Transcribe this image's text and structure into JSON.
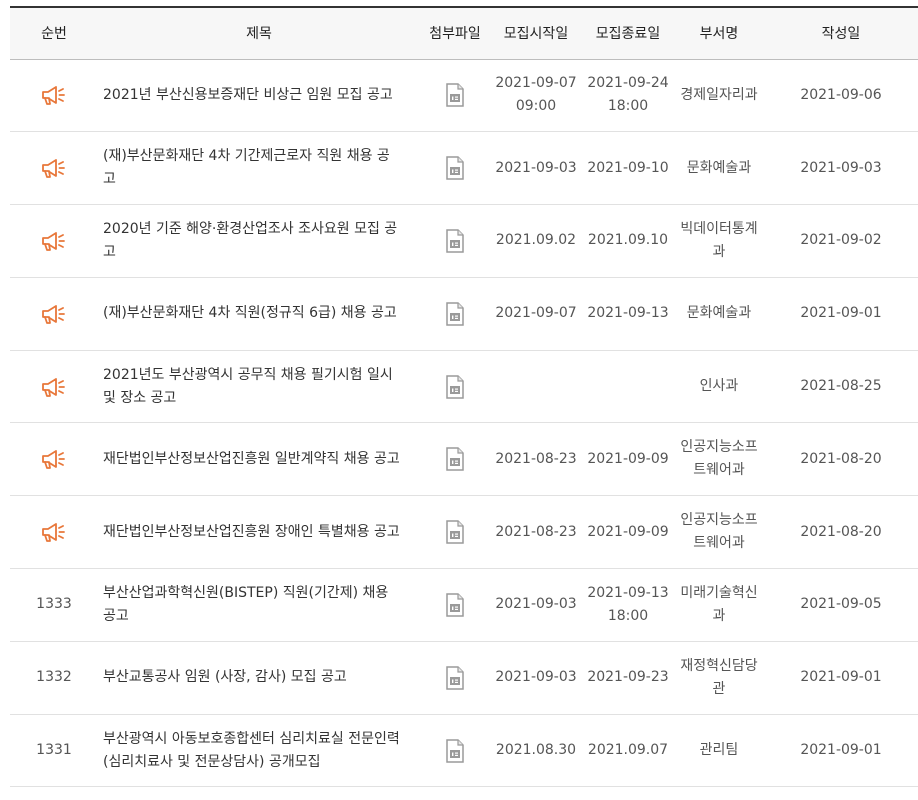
{
  "colors": {
    "notice_icon": "#e8773a",
    "file_icon": "#9a9a9a"
  },
  "columns": [
    "순번",
    "제목",
    "첨부파일",
    "모집시작일",
    "모집종료일",
    "부서명",
    "작성일"
  ],
  "rows": [
    {
      "no": "",
      "is_notice": true,
      "notice_icon": "megaphone-icon",
      "title": "2021년 부산신용보증재단 비상근 임원 모집 공고",
      "file_icon": "hwp-file-icon",
      "start": "2021-09-07 09:00",
      "end": "2021-09-24 18:00",
      "dept": "경제일자리과",
      "date": "2021-09-06"
    },
    {
      "no": "",
      "is_notice": true,
      "notice_icon": "megaphone-icon",
      "title": "(재)부산문화재단 4차 기간제근로자 직원 채용 공고",
      "file_icon": "hwp-file-icon",
      "start": "2021-09-03",
      "end": "2021-09-10",
      "dept": "문화예술과",
      "date": "2021-09-03"
    },
    {
      "no": "",
      "is_notice": true,
      "notice_icon": "megaphone-icon",
      "title": "2020년 기준 해양·환경산업조사 조사요원 모집 공고",
      "file_icon": "hwp-file-icon",
      "start": "2021.09.02",
      "end": "2021.09.10",
      "dept": "빅데이터통계과",
      "date": "2021-09-02"
    },
    {
      "no": "",
      "is_notice": true,
      "notice_icon": "megaphone-icon",
      "title": "(재)부산문화재단 4차 직원(정규직 6급) 채용 공고",
      "file_icon": "hwp-file-icon",
      "start": "2021-09-07",
      "end": "2021-09-13",
      "dept": "문화예술과",
      "date": "2021-09-01"
    },
    {
      "no": "",
      "is_notice": true,
      "notice_icon": "megaphone-icon",
      "title": "2021년도 부산광역시 공무직 채용 필기시험 일시 및 장소 공고",
      "file_icon": "hwp-file-icon",
      "start": "",
      "end": "",
      "dept": "인사과",
      "date": "2021-08-25"
    },
    {
      "no": "",
      "is_notice": true,
      "notice_icon": "megaphone-icon",
      "title": "재단법인부산정보산업진흥원 일반계약직 채용 공고",
      "file_icon": "hwp-file-icon",
      "start": "2021-08-23",
      "end": "2021-09-09",
      "dept": "인공지능소프트웨어과",
      "date": "2021-08-20"
    },
    {
      "no": "",
      "is_notice": true,
      "notice_icon": "megaphone-icon",
      "title": "재단법인부산정보산업진흥원 장애인 특별채용 공고",
      "file_icon": "hwp-file-icon",
      "start": "2021-08-23",
      "end": "2021-09-09",
      "dept": "인공지능소프트웨어과",
      "date": "2021-08-20"
    },
    {
      "no": "1333",
      "is_notice": false,
      "notice_icon": "",
      "title": "부산산업과학혁신원(BISTEP) 직원(기간제) 채용공고",
      "file_icon": "hwp-file-icon",
      "start": "2021-09-03",
      "end": "2021-09-13 18:00",
      "dept": "미래기술혁신과",
      "date": "2021-09-05"
    },
    {
      "no": "1332",
      "is_notice": false,
      "notice_icon": "",
      "title": "부산교통공사 임원 (사장, 감사) 모집 공고",
      "file_icon": "hwp-file-icon",
      "start": "2021-09-03",
      "end": "2021-09-23",
      "dept": "재정혁신담당관",
      "date": "2021-09-01"
    },
    {
      "no": "1331",
      "is_notice": false,
      "notice_icon": "",
      "title": "부산광역시 아동보호종합센터 심리치료실 전문인력(심리치료사 및 전문상담사) 공개모집",
      "file_icon": "hwp-file-icon",
      "start": "2021.08.30",
      "end": "2021.09.07",
      "dept": "관리팀",
      "date": "2021-09-01"
    }
  ]
}
